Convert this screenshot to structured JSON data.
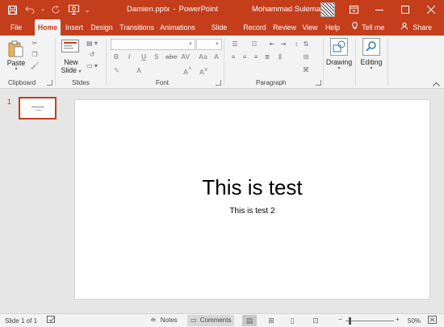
{
  "titlebar": {
    "file_name": "Damien.pptx",
    "separator": "-",
    "app_name": "PowerPoint",
    "user_name": "Mohammad Suleman"
  },
  "qat": {
    "save": "save-icon",
    "undo": "undo-icon",
    "redo": "redo-icon",
    "present": "present-from-start-icon",
    "customize": "customize-qat-icon"
  },
  "window": {
    "ribbon_display": "ribbon-display-options-icon",
    "minimize": "minimize-icon",
    "maximize": "maximize-icon",
    "close": "close-icon"
  },
  "tabs": [
    {
      "label": "File"
    },
    {
      "label": "Home"
    },
    {
      "label": "Insert"
    },
    {
      "label": "Design"
    },
    {
      "label": "Transitions"
    },
    {
      "label": "Animations"
    },
    {
      "label": "Slide Show"
    },
    {
      "label": "Record"
    },
    {
      "label": "Review"
    },
    {
      "label": "View"
    },
    {
      "label": "Help"
    },
    {
      "label": "Tell me"
    },
    {
      "label": "Share"
    }
  ],
  "ribbon": {
    "clipboard": {
      "label": "Clipboard",
      "paste": "Paste"
    },
    "slides": {
      "label": "Slides",
      "new_slide_line1": "New",
      "new_slide_line2": "Slide"
    },
    "font": {
      "label": "Font",
      "font_name": "",
      "font_size": ""
    },
    "paragraph": {
      "label": "Paragraph"
    },
    "drawing": {
      "label": "Drawing"
    },
    "editing": {
      "label": "Editing"
    }
  },
  "thumbnails": [
    {
      "number": "1"
    }
  ],
  "slide": {
    "title": "This is test",
    "subtitle": "This is test 2"
  },
  "status": {
    "slide_info": "Slide 1 of 1",
    "notes": "Notes",
    "comments": "Comments",
    "zoom": "50%",
    "zoom_minus": "−",
    "zoom_plus": "+"
  },
  "colors": {
    "accent": "#c43e1c",
    "ribbon_bg": "#f3f3f3",
    "workspace_bg": "#e6e6e6"
  }
}
